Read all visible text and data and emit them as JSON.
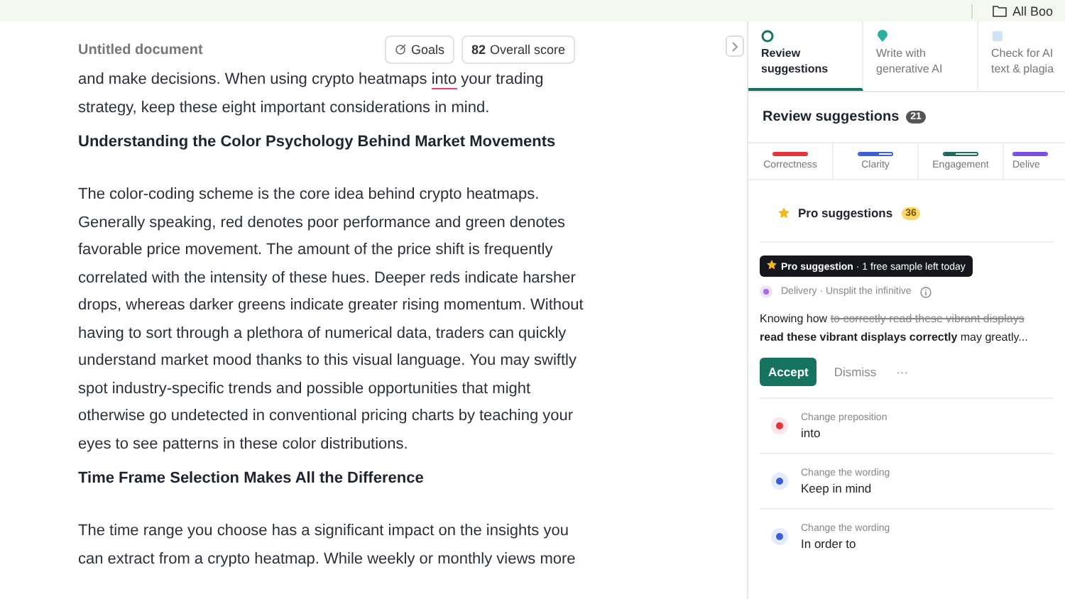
{
  "top_bar": {
    "folder_label": "All Boo"
  },
  "editor": {
    "title": "Untitled document",
    "goals_label": "Goals",
    "score": "82",
    "score_label": "Overall score",
    "blocks": [
      {
        "kind": "paragraph",
        "segments": [
          {
            "text": "and make decisions. When using crypto heatmaps ",
            "flagged": false
          },
          {
            "text": "into",
            "flagged": true
          },
          {
            "text": " your trading strategy, keep these eight important considerations in mind.",
            "flagged": false
          }
        ]
      },
      {
        "kind": "heading",
        "text": "Understanding the Color Psychology Behind Market Movements"
      },
      {
        "kind": "paragraph",
        "segments": [
          {
            "text": "The color-coding scheme is the core idea behind crypto heatmaps. Generally speaking, red denotes poor performance and green denotes favorable price movement. The amount of the price shift is frequently correlated with the intensity of these hues. Deeper reds indicate harsher drops, whereas darker greens indicate greater rising momentum. Without having to sort through a plethora of numerical data, traders can quickly understand market mood thanks to this visual language. You may swiftly spot industry-specific trends and possible opportunities that might otherwise go undetected in conventional pricing charts by teaching your eyes to see patterns in these color distributions.",
            "flagged": false
          }
        ]
      },
      {
        "kind": "heading",
        "text": "Time Frame Selection Makes All the Difference"
      },
      {
        "kind": "paragraph",
        "segments": [
          {
            "text": "The time range you choose has a significant impact on the insights you can extract from a crypto heatmap. While weekly or monthly views more",
            "flagged": false
          }
        ]
      }
    ]
  },
  "panel": {
    "tabs": [
      {
        "label": "Review suggestions",
        "selected": true
      },
      {
        "label": "Write with generative AI",
        "selected": false
      },
      {
        "label": "Check for AI text & plagia",
        "selected": false
      }
    ],
    "heading": "Review suggestions",
    "count": "21",
    "categories": [
      {
        "label": "Correctness",
        "color": "#e5333a",
        "level": 1
      },
      {
        "label": "Clarity",
        "color": "#3c5fd6",
        "level": 0.6
      },
      {
        "label": "Engagement",
        "color": "#1f6b5a",
        "level": 0.35
      },
      {
        "label": "Delive",
        "color": "#7a4fe0",
        "level": 1
      }
    ],
    "pro": {
      "label": "Pro suggestions",
      "count": "36"
    },
    "card": {
      "banner_bold": "Pro suggestion",
      "banner_rest": " · 1 free sample left today",
      "meta": "Delivery · Unsplit the infinitive",
      "text_before": "Knowing how ",
      "text_removed": "to correctly read these vibrant displays",
      "text_added": "read these vibrant displays correctly",
      "text_after": " may greatly...",
      "accept": "Accept",
      "dismiss": "Dismiss",
      "more": "···"
    },
    "suggestions": [
      {
        "kind": "correctness",
        "type": "Change preposition",
        "text": "into"
      },
      {
        "kind": "clarity",
        "type": "Change the wording",
        "text": "Keep in mind"
      },
      {
        "kind": "clarity",
        "type": "Change the wording",
        "text": "In order to"
      }
    ]
  }
}
